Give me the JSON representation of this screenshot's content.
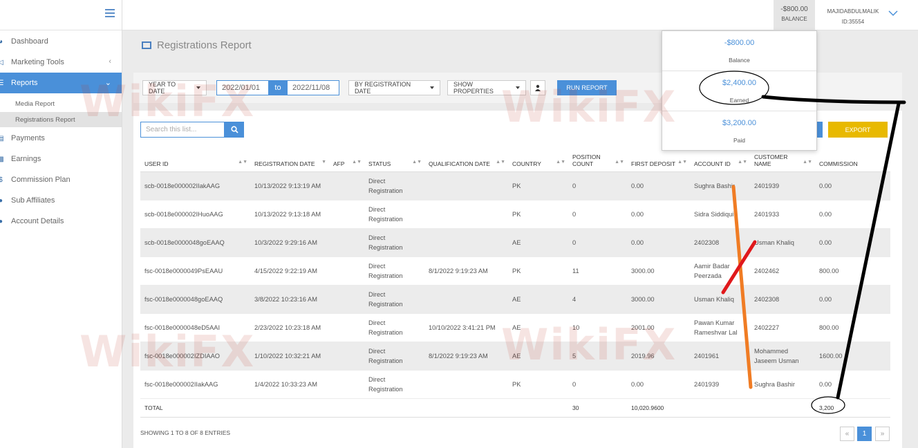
{
  "sidebar": {
    "items": [
      {
        "label": "Dashboard"
      },
      {
        "label": "Marketing Tools"
      },
      {
        "label": "Reports"
      },
      {
        "label": "Payments"
      },
      {
        "label": "Earnings"
      },
      {
        "label": "Commission Plan"
      },
      {
        "label": "Sub Affiliates"
      },
      {
        "label": "Account Details"
      }
    ],
    "sub_items": [
      {
        "label": "Media Report"
      },
      {
        "label": "Registrations Report"
      }
    ]
  },
  "topbar": {
    "balance_amount": "-$800.00",
    "balance_label": "BALANCE",
    "username": "MAJIDABDULMALIK",
    "user_id": "ID:35554"
  },
  "balance_dropdown": {
    "items": [
      {
        "value": "-$800.00",
        "label": "Balance"
      },
      {
        "value": "$2,400.00",
        "label": "Earned"
      },
      {
        "value": "$3,200.00",
        "label": "Paid"
      }
    ]
  },
  "page": {
    "title": "Registrations Report"
  },
  "filters": {
    "period": "YEAR TO DATE",
    "date_from": "2022/01/01",
    "date_to_label": "to",
    "date_to": "2022/11/08",
    "date_type": "BY REGISTRATION DATE",
    "properties": "SHOW PROPERTIES",
    "run_label": "RUN REPORT"
  },
  "search": {
    "placeholder": "Search this list..."
  },
  "export_label": "EXPORT",
  "table": {
    "headers": [
      "USER ID",
      "REGISTRATION DATE",
      "AFP",
      "STATUS",
      "QUALIFICATION DATE",
      "COUNTRY",
      "POSITION COUNT",
      "FIRST DEPOSIT",
      "ACCOUNT ID",
      "CUSTOMER NAME",
      "COMMISSION"
    ],
    "rows": [
      [
        "scb-0018e000002IIakAAG",
        "10/13/2022 9:13:19 AM",
        "",
        "Direct Registration",
        "",
        "PK",
        "0",
        "0.00",
        "Sughra Bashir",
        "2401939",
        "0.00"
      ],
      [
        "scb-0018e000002IHuoAAG",
        "10/13/2022 9:13:18 AM",
        "",
        "Direct Registration",
        "",
        "PK",
        "0",
        "0.00",
        "Sidra Siddiqui",
        "2401933",
        "0.00"
      ],
      [
        "scb-0018e0000048goEAAQ",
        "10/3/2022 9:29:16 AM",
        "",
        "Direct Registration",
        "",
        "AE",
        "0",
        "0.00",
        "2402308",
        "Usman Khaliq",
        "0.00"
      ],
      [
        "fsc-0018e0000049PsEAAU",
        "4/15/2022 9:22:19 AM",
        "",
        "Direct Registration",
        "8/1/2022 9:19:23 AM",
        "PK",
        "11",
        "3000.00",
        "Aamir Badar Peerzada",
        "2402462",
        "800.00"
      ],
      [
        "fsc-0018e0000048goEAAQ",
        "3/8/2022 10:23:16 AM",
        "",
        "Direct Registration",
        "",
        "AE",
        "4",
        "3000.00",
        "Usman Khaliq",
        "2402308",
        "0.00"
      ],
      [
        "fsc-0018e0000048eD5AAI",
        "2/23/2022 10:23:18 AM",
        "",
        "Direct Registration",
        "10/10/2022 3:41:21 PM",
        "AE",
        "10",
        "2001.00",
        "Pawan Kumar Rameshvar Lal",
        "2402227",
        "800.00"
      ],
      [
        "fsc-0018e000002IZDIAAO",
        "1/10/2022 10:32:21 AM",
        "",
        "Direct Registration",
        "8/1/2022 9:19:23 AM",
        "AE",
        "5",
        "2019.96",
        "2401961",
        "Mohammed Jaseem Usman",
        "1600.00"
      ],
      [
        "fsc-0018e000002IIakAAG",
        "1/4/2022 10:33:23 AM",
        "",
        "Direct Registration",
        "",
        "PK",
        "0",
        "0.00",
        "2401939",
        "Sughra Bashir",
        "0.00"
      ]
    ],
    "total": {
      "label": "TOTAL",
      "position_count": "30",
      "first_deposit": "10,020.9600",
      "commission": "3,200"
    }
  },
  "footer": {
    "entries_text": "SHOWING 1 TO 8 OF 8 ENTRIES",
    "pages": [
      "«",
      "1",
      "»"
    ]
  },
  "watermark": "WikiFX",
  "colors": {
    "accent": "#4a90d9",
    "export": "#e8b900",
    "annotation_black": "#000000",
    "annotation_orange": "#f07c24",
    "annotation_red": "#e0181b"
  }
}
